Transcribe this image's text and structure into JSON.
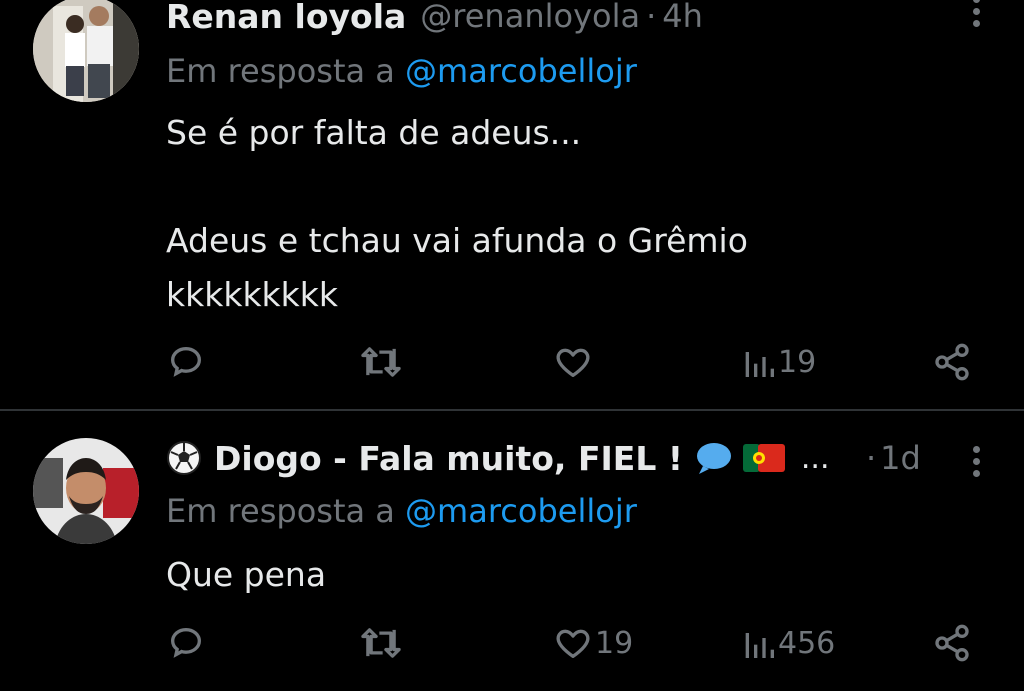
{
  "tweets": [
    {
      "display_name": "Renan loyola",
      "handle": "@renanloyola",
      "separator": "·",
      "time": "4h",
      "reply_prefix": "Em resposta a",
      "reply_mention": "@marcobellojr",
      "text_lines": [
        "Se é por falta de adeus...",
        "",
        "Adeus e tchau vai afunda o Grêmio",
        "kkkkkkkkk"
      ],
      "actions": {
        "reply_count": "",
        "retweet_count": "",
        "like_count": "",
        "views_count": "19"
      }
    },
    {
      "display_name": "Diogo - Fala muito, FIEL !",
      "name_ellipsis": "...",
      "separator": "·",
      "time": "1d",
      "reply_prefix": "Em resposta a",
      "reply_mention": "@marcobellojr",
      "text_lines": [
        "Que pena"
      ],
      "actions": {
        "reply_count": "",
        "retweet_count": "",
        "like_count": "19",
        "views_count": "456"
      }
    }
  ],
  "icons": {
    "reply": "reply-icon",
    "retweet": "retweet-icon",
    "like": "heart-icon",
    "views": "views-icon",
    "share": "share-icon",
    "more": "more-icon",
    "soccer": "soccer-ball-icon",
    "bubble": "speech-bubble-icon",
    "flag": "portugal-flag-icon"
  },
  "colors": {
    "background": "#000000",
    "text": "#e7e9ea",
    "secondary": "#71767b",
    "link": "#1d9bf0",
    "divider": "#2f3336"
  }
}
